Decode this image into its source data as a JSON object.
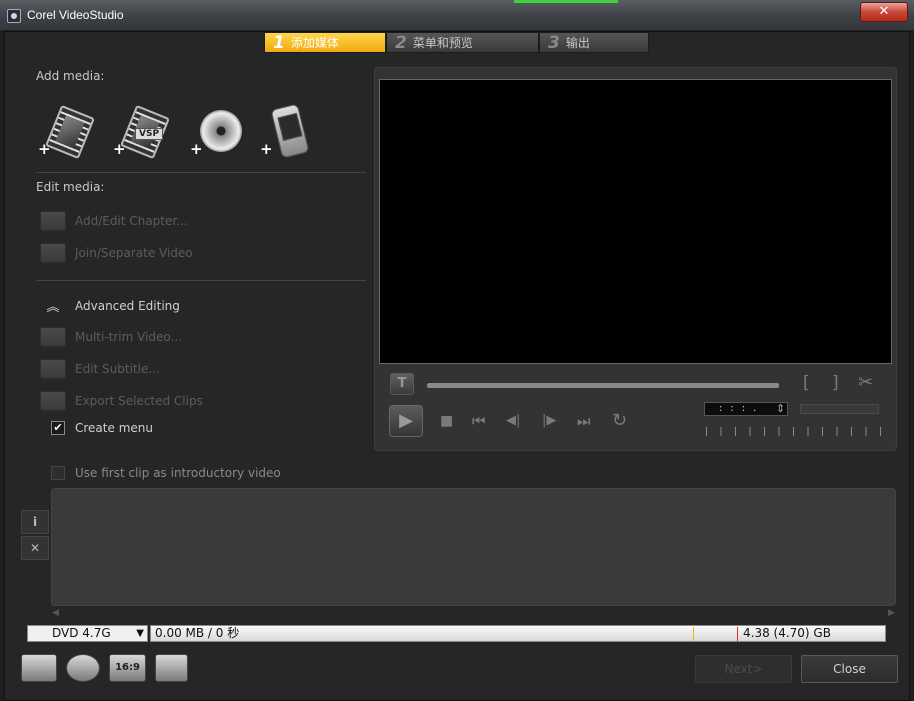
{
  "window": {
    "title": "Corel VideoStudio",
    "close_glyph": "✕"
  },
  "tabs": [
    {
      "num": "1",
      "label": "添加媒体"
    },
    {
      "num": "2",
      "label": "菜单和预览"
    },
    {
      "num": "3",
      "label": "输出"
    }
  ],
  "left": {
    "add_media_label": "Add media:",
    "edit_media_label": "Edit media:",
    "vsp_tag": "VSP",
    "plus": "+",
    "add_edit_chapter": "Add/Edit Chapter...",
    "join_separate": "Join/Separate Video",
    "advanced_editing": "Advanced Editing",
    "multi_trim": "Multi-trim Video...",
    "edit_subtitle": "Edit Subtitle...",
    "export_clips": "Export Selected Clips",
    "create_menu": "Create menu",
    "use_first_clip": "Use first clip as introductory video",
    "check_glyph": "✔"
  },
  "preview": {
    "title_btn": "T",
    "mark_in": "[",
    "mark_out": "]",
    "scissors": "✂",
    "play": "▶",
    "stop": "■",
    "home": "⏮",
    "prev": "◀|",
    "next": "|▶",
    "end": "⏭",
    "repeat": "↻",
    "timecode": ":::.",
    "spin": "⇕"
  },
  "info": {
    "info_btn": "i",
    "delete_btn": "✕",
    "scroll_left": "◀",
    "scroll_right": "▶"
  },
  "disc": {
    "selected": "DVD 4.7G",
    "arrow": "▼",
    "usage": "0.00 MB / 0 秒",
    "total": "4.38 (4.70) GB"
  },
  "toolbar": {
    "aspect_label": "16:9",
    "next_label": "Next>",
    "close_label": "Close"
  },
  "colors": {
    "active_tab": "#f0a910",
    "background": "#262626",
    "preview_screen": "#000000"
  }
}
